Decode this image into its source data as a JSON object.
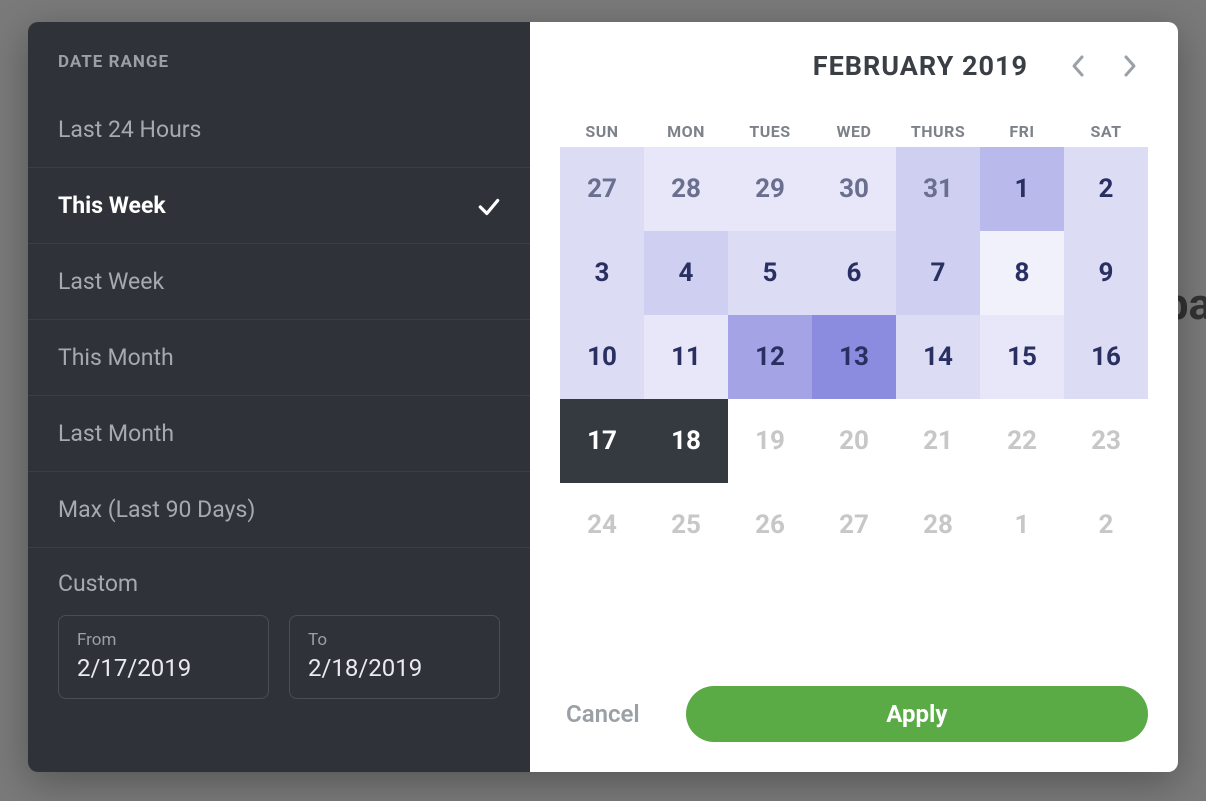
{
  "sidebar": {
    "header": "DATE RANGE",
    "presets": [
      {
        "label": "Last 24 Hours",
        "active": false
      },
      {
        "label": "This Week",
        "active": true
      },
      {
        "label": "Last Week",
        "active": false
      },
      {
        "label": "This Month",
        "active": false
      },
      {
        "label": "Last Month",
        "active": false
      },
      {
        "label": "Max (Last 90 Days)",
        "active": false
      }
    ],
    "custom_label": "Custom",
    "from_label": "From",
    "from_value": "2/17/2019",
    "to_label": "To",
    "to_value": "2/18/2019"
  },
  "calendar": {
    "title": "FEBRUARY 2019",
    "weekdays": [
      "SUN",
      "MON",
      "TUES",
      "WED",
      "THURS",
      "FRI",
      "SAT"
    ],
    "cells": [
      {
        "d": "27",
        "kind": "prev",
        "heat": 3,
        "selected": false
      },
      {
        "d": "28",
        "kind": "prev",
        "heat": 2,
        "selected": false
      },
      {
        "d": "29",
        "kind": "prev",
        "heat": 2,
        "selected": false
      },
      {
        "d": "30",
        "kind": "prev",
        "heat": 2,
        "selected": false
      },
      {
        "d": "31",
        "kind": "prev",
        "heat": 4,
        "selected": false
      },
      {
        "d": "1",
        "kind": "cur",
        "heat": 5,
        "selected": false
      },
      {
        "d": "2",
        "kind": "cur",
        "heat": 3,
        "selected": false
      },
      {
        "d": "3",
        "kind": "cur",
        "heat": 3,
        "selected": false
      },
      {
        "d": "4",
        "kind": "cur",
        "heat": 4,
        "selected": false
      },
      {
        "d": "5",
        "kind": "cur",
        "heat": 3,
        "selected": false
      },
      {
        "d": "6",
        "kind": "cur",
        "heat": 3,
        "selected": false
      },
      {
        "d": "7",
        "kind": "cur",
        "heat": 4,
        "selected": false
      },
      {
        "d": "8",
        "kind": "cur",
        "heat": 1,
        "selected": false
      },
      {
        "d": "9",
        "kind": "cur",
        "heat": 3,
        "selected": false
      },
      {
        "d": "10",
        "kind": "cur",
        "heat": 3,
        "selected": false
      },
      {
        "d": "11",
        "kind": "cur",
        "heat": 2,
        "selected": false
      },
      {
        "d": "12",
        "kind": "cur",
        "heat": 6,
        "selected": false
      },
      {
        "d": "13",
        "kind": "cur",
        "heat": 7,
        "selected": false
      },
      {
        "d": "14",
        "kind": "cur",
        "heat": 3,
        "selected": false
      },
      {
        "d": "15",
        "kind": "cur",
        "heat": 2,
        "selected": false
      },
      {
        "d": "16",
        "kind": "cur",
        "heat": 3,
        "selected": false
      },
      {
        "d": "17",
        "kind": "cur",
        "heat": 0,
        "selected": true
      },
      {
        "d": "18",
        "kind": "cur",
        "heat": 0,
        "selected": true
      },
      {
        "d": "19",
        "kind": "dis",
        "heat": 0,
        "selected": false
      },
      {
        "d": "20",
        "kind": "dis",
        "heat": 0,
        "selected": false
      },
      {
        "d": "21",
        "kind": "dis",
        "heat": 0,
        "selected": false
      },
      {
        "d": "22",
        "kind": "dis",
        "heat": 0,
        "selected": false
      },
      {
        "d": "23",
        "kind": "dis",
        "heat": 0,
        "selected": false
      },
      {
        "d": "24",
        "kind": "dis",
        "heat": 0,
        "selected": false
      },
      {
        "d": "25",
        "kind": "dis",
        "heat": 0,
        "selected": false
      },
      {
        "d": "26",
        "kind": "dis",
        "heat": 0,
        "selected": false
      },
      {
        "d": "27",
        "kind": "dis",
        "heat": 0,
        "selected": false
      },
      {
        "d": "28",
        "kind": "dis",
        "heat": 0,
        "selected": false
      },
      {
        "d": "1",
        "kind": "dis",
        "heat": 0,
        "selected": false
      },
      {
        "d": "2",
        "kind": "dis",
        "heat": 0,
        "selected": false
      }
    ]
  },
  "footer": {
    "cancel": "Cancel",
    "apply": "Apply"
  },
  "bg_hint": "ba"
}
